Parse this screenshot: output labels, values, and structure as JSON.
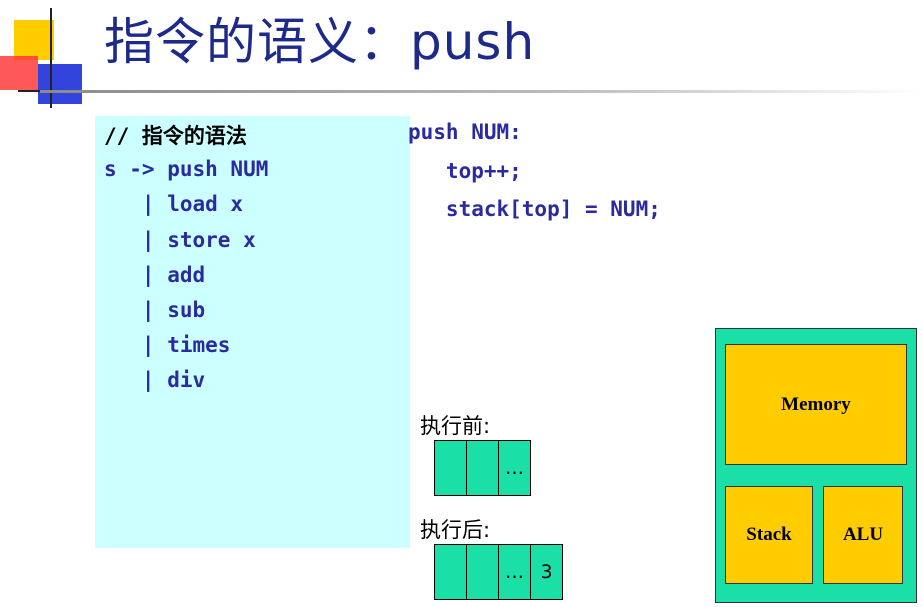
{
  "slide": {
    "title": "指令的语义：push"
  },
  "grammar": {
    "comment": "// 指令的语法",
    "lines": [
      "s -> push NUM",
      "   | load x",
      "   | store x",
      "   | add",
      "   | sub",
      "   | times",
      "   | div"
    ]
  },
  "semantics": {
    "lines": [
      "push NUM:",
      "   top++;",
      "   stack[top] = NUM;"
    ]
  },
  "before": {
    "label": "执行前:",
    "cells": [
      "",
      "",
      "…"
    ]
  },
  "after": {
    "label": "执行后:",
    "cells": [
      "",
      "",
      "…",
      "3"
    ]
  },
  "machine": {
    "memory": "Memory",
    "stack": "Stack",
    "alu": "ALU"
  },
  "colors": {
    "title": "#1e2a8a",
    "code": "#2b2ba0",
    "grammar_bg": "#ccffff",
    "cell": "#1ae0a8",
    "component": "#ffcc00"
  }
}
